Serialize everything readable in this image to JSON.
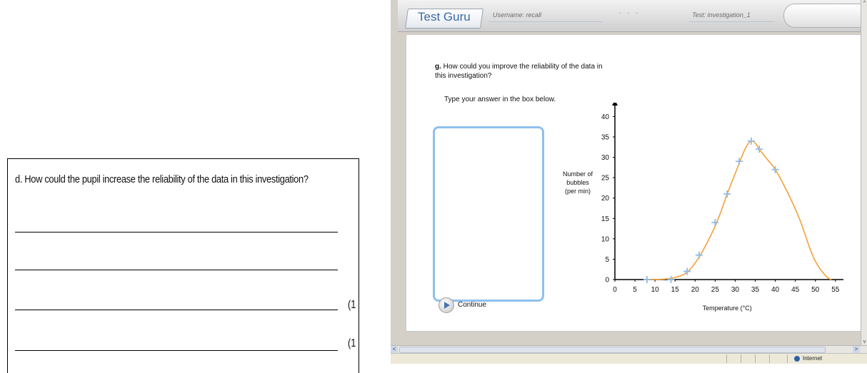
{
  "paper": {
    "question": "d.  How could the pupil increase the reliability of the data in this investigation?",
    "marks": [
      "(1",
      "(1"
    ]
  },
  "app": {
    "logo": "Test Guru",
    "username": "Username: recall",
    "dots": "- - -",
    "test_name": "Test: investigation_1"
  },
  "question": {
    "letter": "g.",
    "text": "How could you improve the reliability of the data in this investigation?",
    "instruction": "Type your answer in the box below.",
    "continue_label": "Continue"
  },
  "chart_data": {
    "type": "scatter",
    "ylabel_lines": [
      "Number of",
      "bubbles",
      "(per min)"
    ],
    "xlabel": "Temperature (°C)",
    "x_ticks": [
      0,
      5,
      10,
      15,
      20,
      25,
      30,
      35,
      40,
      45,
      50,
      55
    ],
    "y_ticks": [
      0,
      5,
      10,
      15,
      20,
      25,
      30,
      35,
      40
    ],
    "xlim": [
      0,
      57
    ],
    "ylim": [
      0,
      42
    ],
    "points": [
      {
        "x": 8,
        "y": 0
      },
      {
        "x": 14,
        "y": 0
      },
      {
        "x": 18,
        "y": 2
      },
      {
        "x": 21,
        "y": 6
      },
      {
        "x": 25,
        "y": 14
      },
      {
        "x": 28,
        "y": 21
      },
      {
        "x": 31,
        "y": 29
      },
      {
        "x": 34,
        "y": 34
      },
      {
        "x": 36,
        "y": 32
      },
      {
        "x": 40,
        "y": 27
      }
    ],
    "curve": [
      [
        8,
        0
      ],
      [
        12,
        0.1
      ],
      [
        15,
        0.5
      ],
      [
        18,
        1.8
      ],
      [
        21,
        5.5
      ],
      [
        24,
        11
      ],
      [
        26,
        15.5
      ],
      [
        28,
        21
      ],
      [
        30,
        26
      ],
      [
        32,
        31
      ],
      [
        33,
        33
      ],
      [
        34,
        34
      ],
      [
        35,
        33.5
      ],
      [
        36,
        32
      ],
      [
        38,
        29.5
      ],
      [
        40,
        27
      ],
      [
        43,
        21.5
      ],
      [
        46,
        15
      ],
      [
        48.5,
        8
      ],
      [
        50,
        4.5
      ],
      [
        51.5,
        2.2
      ],
      [
        53,
        0.5
      ],
      [
        54,
        0
      ]
    ],
    "point_color": "#8fbbe8",
    "curve_color": "#f2a23a"
  },
  "status": {
    "zone": "Internet"
  },
  "scroll": {
    "left_arrow": "<",
    "right_arrow": ">",
    "up_arrow": "^",
    "down_arrow": "v"
  }
}
